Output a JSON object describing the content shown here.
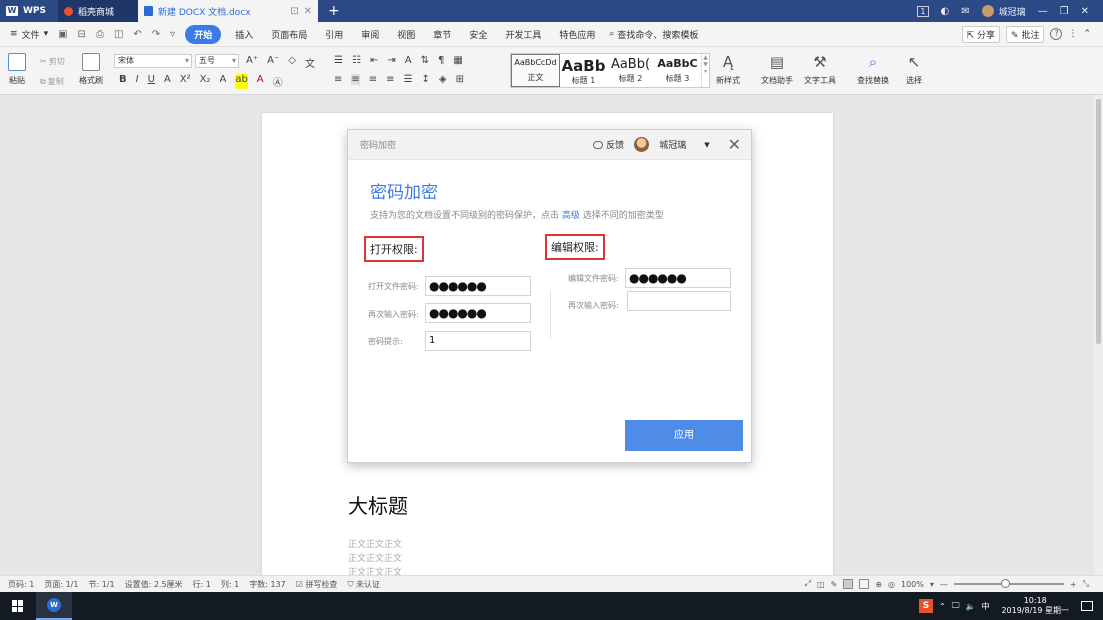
{
  "titlebar": {
    "tabs": [
      {
        "label": "WPS",
        "logo": "W"
      },
      {
        "label": "稻壳商城"
      },
      {
        "label": "新建 DOCX 文档.docx"
      }
    ],
    "badge": "1",
    "user_name": "城冠璃",
    "colors": {
      "bar": "#2b4a85",
      "active_tab": "#f4f4f4",
      "doc_tab_text": "#2b6cd4"
    }
  },
  "menubar": {
    "file": "文件",
    "items": [
      "开始",
      "插入",
      "页面布局",
      "引用",
      "审阅",
      "视图",
      "章节",
      "安全",
      "开发工具",
      "特色应用"
    ],
    "active": "开始",
    "search": "查找命令、搜索模板",
    "share": "分享",
    "comment": "批注",
    "help": "?"
  },
  "ribbon": {
    "paste": "粘贴",
    "cut": "剪切",
    "copy": "复制",
    "format_painter": "格式刷",
    "font": "宋体",
    "size": "五号",
    "styles": [
      {
        "preview": "AaBbCcDd",
        "label": "正文"
      },
      {
        "preview": "AaBb",
        "label": "标题 1"
      },
      {
        "preview": "AaBb(",
        "label": "标题 2"
      },
      {
        "preview": "AaBbC",
        "label": "标题 3"
      }
    ],
    "new_style": "新样式",
    "doc_helper": "文档助手",
    "text_tools": "文字工具",
    "find_replace": "查找替换",
    "select": "选择"
  },
  "document": {
    "heading": "大标题",
    "body_lines": [
      "正文正文正文",
      "正文正文正文",
      "正文正文正文"
    ]
  },
  "dialog": {
    "window_title": "密码加密",
    "feedback": "反馈",
    "user_name": "城冠璃",
    "heading": "密码加密",
    "description_pre": "支持为您的文档设置不同级别的密码保护，点击",
    "description_link": "高级",
    "description_post": "选择不同的加密类型",
    "open_section": {
      "title": "打开权限:",
      "password_label": "打开文件密码:",
      "password_value": "●●●●●●",
      "confirm_label": "再次输入密码:",
      "confirm_value": "●●●●●●",
      "hint_label": "密码提示:",
      "hint_value": "1"
    },
    "edit_section": {
      "title": "编辑权限:",
      "password_label": "编辑文件密码:",
      "password_value": "●●●●●●",
      "confirm_label": "再次输入密码:",
      "confirm_value": ""
    },
    "apply_button": "应用",
    "colors": {
      "accent": "#3c7be6",
      "button": "#4f8ce8",
      "highlight_box": "#e03333"
    }
  },
  "statusbar": {
    "page_num": "页码: 1",
    "pages": "页面: 1/1",
    "section": "节: 1/1",
    "setting": "设置值: 2.5厘米",
    "row": "行: 1",
    "col": "列: 1",
    "word_count": "字数: 137",
    "spell_check": "拼写检查",
    "cert": "未认证",
    "zoom": "100%",
    "zoom_level": 1.0
  },
  "taskbar": {
    "time": "10:18",
    "date": "2019/8/19 星期一",
    "ime": "S"
  }
}
